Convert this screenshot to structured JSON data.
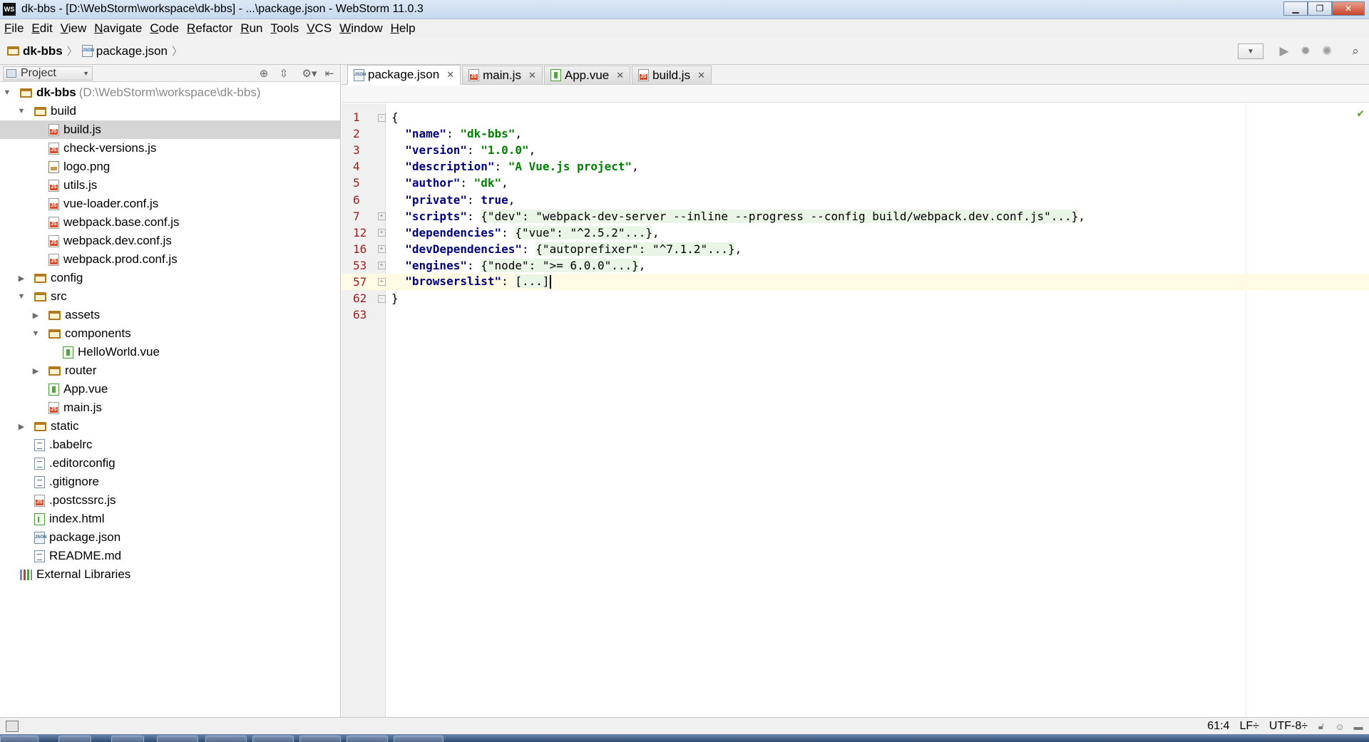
{
  "window": {
    "title": "dk-bbs - [D:\\WebStorm\\workspace\\dk-bbs] - ...\\package.json - WebStorm 11.0.3",
    "logo_text": "WS"
  },
  "menu": [
    {
      "label": "File",
      "mnemonic": "F",
      "rest": "ile"
    },
    {
      "label": "Edit",
      "mnemonic": "E",
      "rest": "dit"
    },
    {
      "label": "View",
      "mnemonic": "V",
      "rest": "iew"
    },
    {
      "label": "Navigate",
      "mnemonic": "N",
      "rest": "avigate"
    },
    {
      "label": "Code",
      "mnemonic": "C",
      "rest": "ode"
    },
    {
      "label": "Refactor",
      "mnemonic": "R",
      "rest": "efactor"
    },
    {
      "label": "Run",
      "mnemonic": "R",
      "rest": "un"
    },
    {
      "label": "Tools",
      "mnemonic": "T",
      "rest": "ools"
    },
    {
      "label": "VCS",
      "mnemonic": "V",
      "rest": "CS"
    },
    {
      "label": "Window",
      "mnemonic": "W",
      "rest": "indow"
    },
    {
      "label": "Help",
      "mnemonic": "H",
      "rest": "elp"
    }
  ],
  "navbar": {
    "project": "dk-bbs",
    "file": "package.json"
  },
  "project_panel": {
    "selector_label": "Project",
    "tree": [
      {
        "depth": 0,
        "arrow": "down",
        "icon": "folder",
        "name": "dk-bbs",
        "path": "(D:\\WebStorm\\workspace\\dk-bbs)",
        "bold": true
      },
      {
        "depth": 1,
        "arrow": "down",
        "icon": "folder",
        "name": "build"
      },
      {
        "depth": 2,
        "arrow": "none",
        "icon": "js",
        "name": "build.js",
        "selected": true
      },
      {
        "depth": 2,
        "arrow": "none",
        "icon": "js",
        "name": "check-versions.js"
      },
      {
        "depth": 2,
        "arrow": "none",
        "icon": "img",
        "name": "logo.png"
      },
      {
        "depth": 2,
        "arrow": "none",
        "icon": "js",
        "name": "utils.js"
      },
      {
        "depth": 2,
        "arrow": "none",
        "icon": "js",
        "name": "vue-loader.conf.js"
      },
      {
        "depth": 2,
        "arrow": "none",
        "icon": "js",
        "name": "webpack.base.conf.js"
      },
      {
        "depth": 2,
        "arrow": "none",
        "icon": "js",
        "name": "webpack.dev.conf.js"
      },
      {
        "depth": 2,
        "arrow": "none",
        "icon": "js",
        "name": "webpack.prod.conf.js"
      },
      {
        "depth": 1,
        "arrow": "right",
        "icon": "folder",
        "name": "config"
      },
      {
        "depth": 1,
        "arrow": "down",
        "icon": "folder",
        "name": "src"
      },
      {
        "depth": 2,
        "arrow": "right",
        "icon": "folder",
        "name": "assets"
      },
      {
        "depth": 2,
        "arrow": "down",
        "icon": "folder",
        "name": "components"
      },
      {
        "depth": 3,
        "arrow": "none",
        "icon": "vue",
        "name": "HelloWorld.vue"
      },
      {
        "depth": 2,
        "arrow": "right",
        "icon": "folder",
        "name": "router"
      },
      {
        "depth": 2,
        "arrow": "none",
        "icon": "vue",
        "name": "App.vue"
      },
      {
        "depth": 2,
        "arrow": "none",
        "icon": "js",
        "name": "main.js"
      },
      {
        "depth": 1,
        "arrow": "right",
        "icon": "folder",
        "name": "static"
      },
      {
        "depth": 1,
        "arrow": "none",
        "icon": "txt",
        "name": ".babelrc"
      },
      {
        "depth": 1,
        "arrow": "none",
        "icon": "txt",
        "name": ".editorconfig"
      },
      {
        "depth": 1,
        "arrow": "none",
        "icon": "txt",
        "name": ".gitignore"
      },
      {
        "depth": 1,
        "arrow": "none",
        "icon": "js",
        "name": ".postcssrc.js"
      },
      {
        "depth": 1,
        "arrow": "none",
        "icon": "html",
        "name": "index.html"
      },
      {
        "depth": 1,
        "arrow": "none",
        "icon": "json",
        "name": "package.json"
      },
      {
        "depth": 1,
        "arrow": "none",
        "icon": "txt",
        "name": "README.md"
      },
      {
        "depth": 0,
        "arrow": "none",
        "icon": "lib",
        "name": "External Libraries"
      }
    ]
  },
  "tabs": [
    {
      "label": "package.json",
      "icon": "json",
      "active": true
    },
    {
      "label": "main.js",
      "icon": "js",
      "active": false
    },
    {
      "label": "App.vue",
      "icon": "vue",
      "active": false
    },
    {
      "label": "build.js",
      "icon": "js",
      "active": false
    }
  ],
  "code_lines": [
    {
      "num": "1",
      "fold": "open",
      "html": "{"
    },
    {
      "num": "2",
      "fold": "",
      "html": "  <span class='k'>\"name\"</span>: <span class='s'>\"dk-bbs\"</span>,"
    },
    {
      "num": "3",
      "fold": "",
      "html": "  <span class='k'>\"version\"</span>: <span class='s'>\"1.0.0\"</span>,"
    },
    {
      "num": "4",
      "fold": "",
      "html": "  <span class='k'>\"description\"</span>: <span class='s'>\"A Vue.js project\"</span>,"
    },
    {
      "num": "5",
      "fold": "",
      "html": "  <span class='k'>\"author\"</span>: <span class='s'>\"dk\"</span>,"
    },
    {
      "num": "6",
      "fold": "",
      "html": "  <span class='k'>\"private\"</span>: <span class='kw'>true</span>,"
    },
    {
      "num": "7",
      "fold": "box",
      "html": "  <span class='k'>\"scripts\"</span>: <span class='folded'>{\"dev\": \"webpack-dev-server --inline --progress --config build/webpack.dev.conf.js\"...}</span>,"
    },
    {
      "num": "12",
      "fold": "box",
      "html": "  <span class='k'>\"dependencies\"</span>: <span class='folded'>{\"vue\": \"^2.5.2\"...}</span>,"
    },
    {
      "num": "16",
      "fold": "box",
      "html": "  <span class='k'>\"devDependencies\"</span>: <span class='folded'>{\"autoprefixer\": \"^7.1.2\"...}</span>,"
    },
    {
      "num": "53",
      "fold": "box",
      "html": "  <span class='k'>\"engines\"</span>: <span class='folded'>{\"node\": \">= 6.0.0\"...}</span>,"
    },
    {
      "num": "57",
      "fold": "box",
      "html": "  <span class='k'>\"browserslist\"</span>: <span class='folded'>[...]</span><span class='caret-bar'></span>",
      "current": true
    },
    {
      "num": "62",
      "fold": "open",
      "html": "}"
    },
    {
      "num": "63",
      "fold": "",
      "html": ""
    }
  ],
  "status": {
    "position": "61:4",
    "line_sep": "LF÷",
    "encoding": "UTF-8÷"
  }
}
